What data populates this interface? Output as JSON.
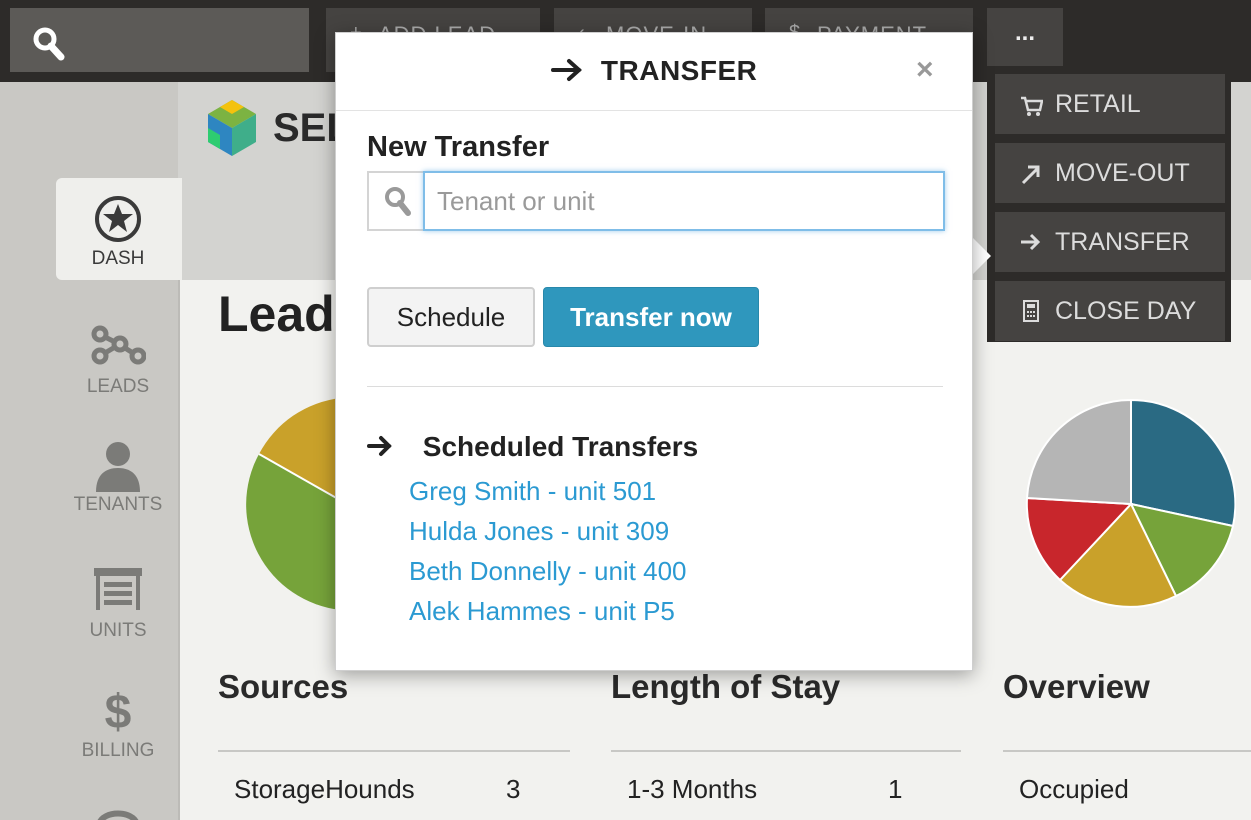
{
  "topbar": {
    "buttons": [
      {
        "label": "ADD LEAD",
        "icon": "plus-icon"
      },
      {
        "label": "MOVE-IN",
        "icon": "chevron-icon"
      },
      {
        "label": "PAYMENT",
        "icon": "dollar-icon"
      }
    ],
    "more_label": "..."
  },
  "menu": {
    "items": [
      {
        "label": "RETAIL",
        "icon": "cart-icon"
      },
      {
        "label": "MOVE-OUT",
        "icon": "arrow-up-right-icon"
      },
      {
        "label": "TRANSFER",
        "icon": "arrow-right-icon"
      },
      {
        "label": "CLOSE DAY",
        "icon": "calculator-icon"
      }
    ]
  },
  "brand": {
    "text": "SEL"
  },
  "sidebar": {
    "items": [
      {
        "label": "DASH",
        "icon": "star-icon"
      },
      {
        "label": "LEADS",
        "icon": "leads-icon"
      },
      {
        "label": "TENANTS",
        "icon": "person-icon"
      },
      {
        "label": "UNITS",
        "icon": "garage-icon"
      },
      {
        "label": "BILLING",
        "icon": "dollar-icon"
      }
    ]
  },
  "main": {
    "heading": "Lead",
    "sections": [
      {
        "title": "Sources",
        "row_label": "StorageHounds",
        "row_value": "3"
      },
      {
        "title": "Length of Stay",
        "row_label": "1-3 Months",
        "row_value": "1"
      },
      {
        "title": "Overview",
        "row_label": "Occupied",
        "row_value": ""
      }
    ]
  },
  "colors": {
    "pie_teal": "#2a6a83",
    "pie_green": "#76a33a",
    "pie_yellow": "#c9a12a",
    "pie_red": "#c8262c",
    "pie_gray": "#b5b5b5",
    "accent_blue": "#2f97bd",
    "link_blue": "#2b9ad2"
  },
  "modal": {
    "title": "TRANSFER",
    "close_label": "×",
    "new_transfer_label": "New Transfer",
    "search_placeholder": "Tenant or unit",
    "search_value": "",
    "schedule_label": "Schedule",
    "transfer_now_label": "Transfer now",
    "scheduled_heading": "Scheduled Transfers",
    "scheduled": [
      "Greg Smith - unit 501",
      "Hulda Jones - unit 309",
      "Beth Donnelly - unit 400",
      "Alek Hammes - unit P5"
    ]
  }
}
